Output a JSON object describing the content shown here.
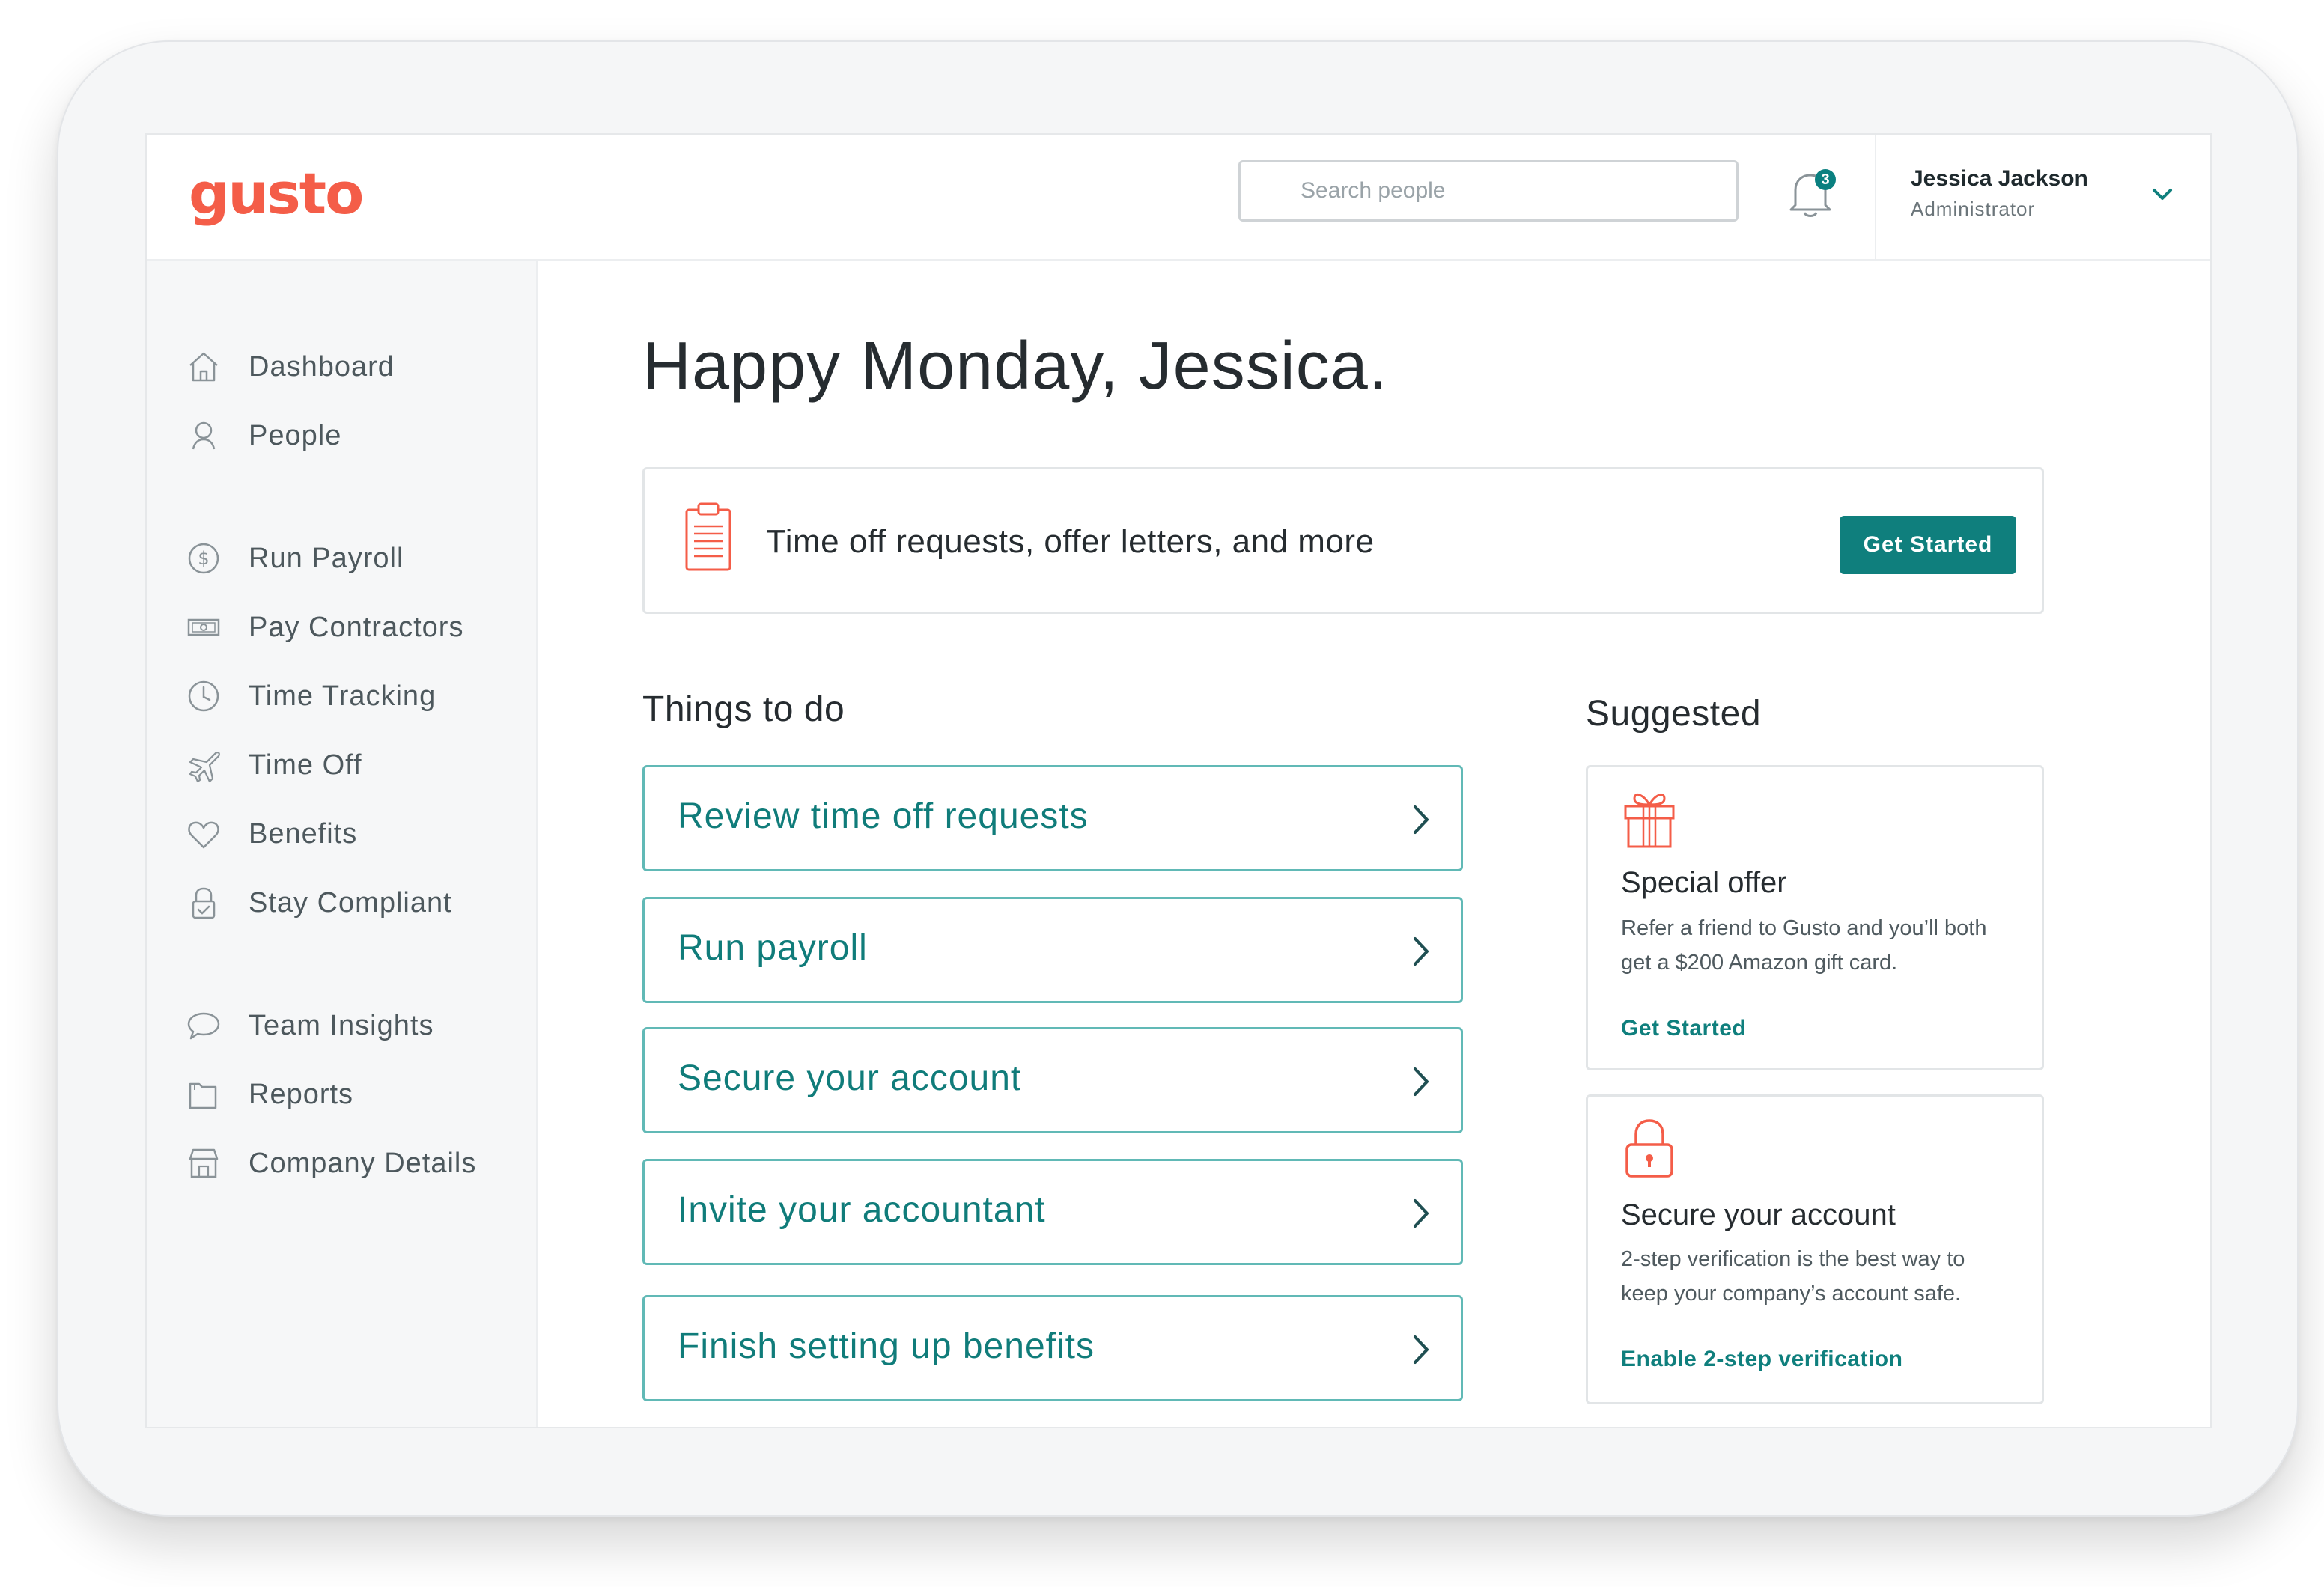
{
  "app": {
    "logo_text": "gusto",
    "brand_color": "#f45d48",
    "accent_color": "#0f7f7d"
  },
  "header": {
    "search_placeholder": "Search people",
    "notifications": {
      "icon": "bell-icon",
      "count": "3"
    },
    "user": {
      "name": "Jessica Jackson",
      "role": "Administrator",
      "menu_icon": "chevron-down-icon"
    }
  },
  "sidebar": {
    "items": [
      {
        "label": "Dashboard",
        "icon": "home-icon"
      },
      {
        "label": "People",
        "icon": "person-icon"
      },
      {
        "label": "Run Payroll",
        "icon": "dollar-icon"
      },
      {
        "label": "Pay Contractors",
        "icon": "cash-icon"
      },
      {
        "label": "Time Tracking",
        "icon": "clock-icon"
      },
      {
        "label": "Time Off",
        "icon": "airplane-icon"
      },
      {
        "label": "Benefits",
        "icon": "heart-icon"
      },
      {
        "label": "Stay Compliant",
        "icon": "compliance-icon"
      },
      {
        "label": "Team Insights",
        "icon": "chat-icon"
      },
      {
        "label": "Reports",
        "icon": "folder-icon"
      },
      {
        "label": "Company Details",
        "icon": "store-icon"
      }
    ]
  },
  "main": {
    "greeting": "Happy Monday, Jessica.",
    "banner": {
      "text": "Time off requests, offer letters, and more",
      "button": "Get Started",
      "icon": "clipboard-icon"
    },
    "todo_title": "Things to do",
    "todos": [
      "Review time off requests",
      "Run payroll",
      "Secure your account",
      "Invite your accountant",
      "Finish setting up benefits"
    ],
    "suggested_title": "Suggested",
    "suggested": [
      {
        "icon": "gift-icon",
        "title": "Special offer",
        "body": "Refer a friend to Gusto and you’ll both get a $200 Amazon gift card.",
        "link": "Get Started"
      },
      {
        "icon": "lock-icon",
        "title": "Secure your account",
        "body": "2-step verification is the best way to keep your company’s account safe.",
        "link": "Enable 2-step verification"
      }
    ]
  }
}
